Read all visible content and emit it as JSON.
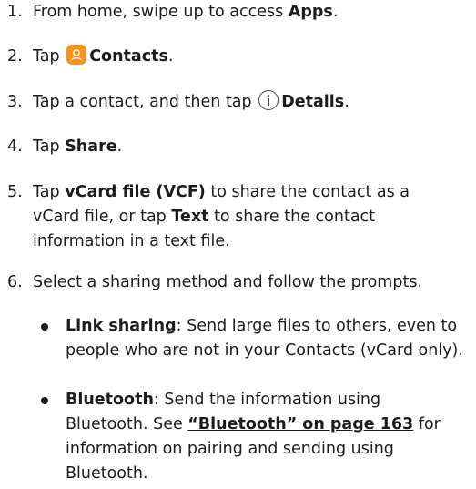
{
  "steps": [
    {
      "num": "1.",
      "prefix": "From home, swipe up to access ",
      "bold": "Apps",
      "suffix": "."
    },
    {
      "num": "2.",
      "prefix": "Tap ",
      "icon": "contacts-app-icon",
      "bold": "Contacts",
      "suffix": "."
    },
    {
      "num": "3.",
      "prefix": "Tap a contact, and then tap ",
      "icon": "info-icon",
      "bold": "Details",
      "suffix": "."
    },
    {
      "num": "4.",
      "prefix": "Tap ",
      "bold": "Share",
      "suffix": "."
    },
    {
      "num": "5.",
      "prefix": "Tap ",
      "bold": "vCard file (VCF)",
      "middle": " to share the contact as a vCard file, or tap ",
      "bold2": "Text",
      "suffix": " to share the contact information in a text file."
    },
    {
      "num": "6.",
      "text": "Select a sharing method and follow the prompts."
    }
  ],
  "bullets": [
    {
      "bold": "Link sharing",
      "text": ": Send large files to others, even to people who are not in your Contacts (vCard only)."
    },
    {
      "bold": "Bluetooth",
      "text_before": ": Send the information using Bluetooth. See ",
      "link": "“Bluetooth” on page 163",
      "text_after": " for information on pairing and sending using Bluetooth."
    }
  ],
  "colors": {
    "contacts_icon": "#f7931e",
    "text": "#1c1c1c"
  }
}
